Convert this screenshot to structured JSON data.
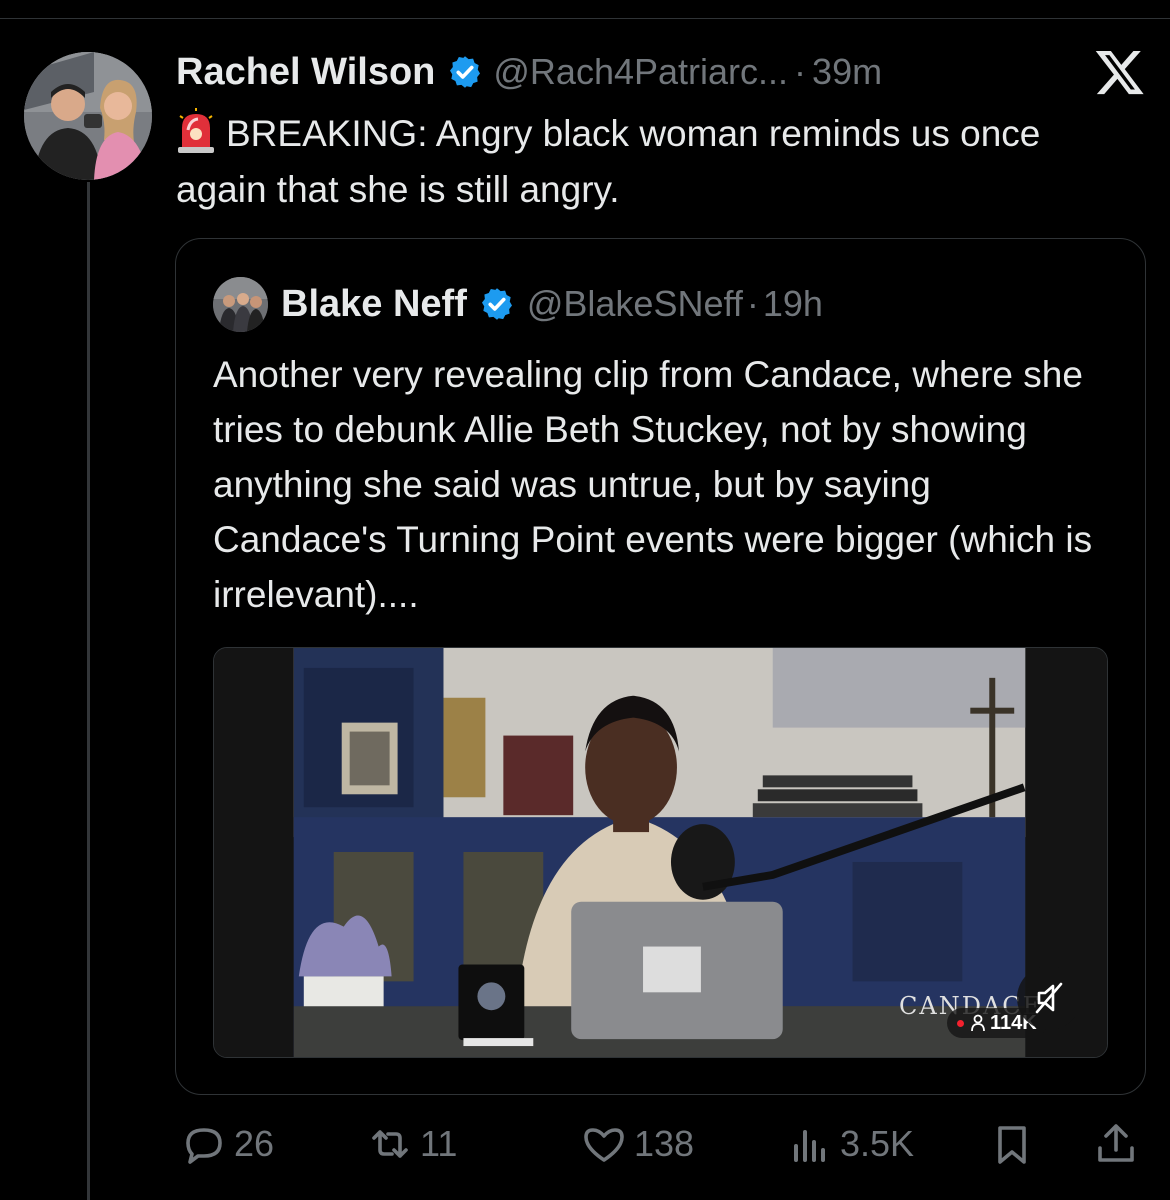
{
  "post": {
    "author_name": "Rachel Wilson",
    "handle": "@Rach4Patriarc...",
    "separator": "·",
    "time": "39m",
    "text": "BREAKING: Angry black woman reminds us once again that she is still angry."
  },
  "quoted": {
    "author_name": "Blake Neff",
    "handle": "@BlakeSNeff",
    "separator": "·",
    "time": "19h",
    "text": "Another very revealing clip from Candace, where she tries to debunk Allie Beth Stuckey, not by showing anything she said was untrue, but by saying Candace's Turning Point events were bigger (which is irrelevant)....",
    "video": {
      "watermark": "CANDACE",
      "viewer_count": "114K"
    }
  },
  "actions": {
    "replies": "26",
    "reposts": "11",
    "likes": "138",
    "views": "3.5K"
  },
  "icons": {
    "verified": "verified-badge-icon",
    "brand": "x-logo-icon",
    "siren": "police-siren-emoji-icon",
    "reply": "reply-bubble-icon",
    "repost": "repost-icon",
    "like": "heart-icon",
    "views": "analytics-bars-icon",
    "bookmark": "bookmark-icon",
    "share": "share-icon",
    "mute": "muted-speaker-icon"
  },
  "colors": {
    "background": "#000000",
    "text": "#e7e9ea",
    "muted": "#71767b",
    "verified": "#1d9bf0",
    "border": "#2f3336"
  }
}
